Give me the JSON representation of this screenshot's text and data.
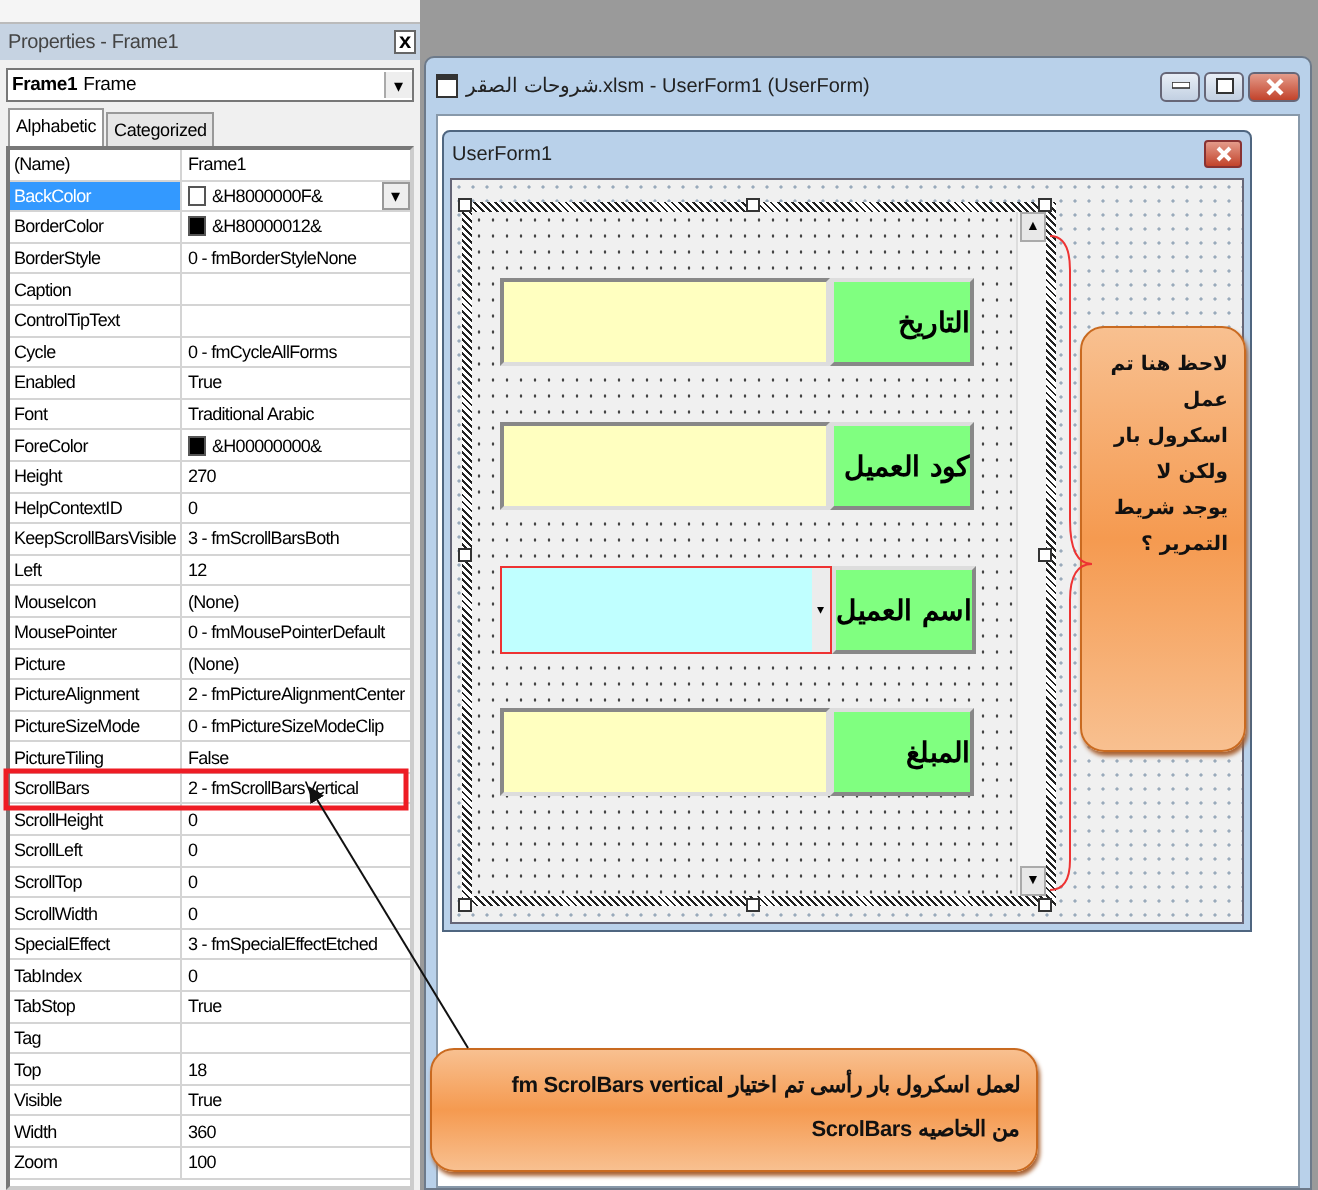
{
  "properties_window": {
    "title": "Properties - Frame1",
    "close_button": "x",
    "object_combo": {
      "name": "Frame1",
      "type": "Frame",
      "arrow": "▾"
    },
    "tabs": [
      {
        "label": "Alphabetic",
        "selected": true
      },
      {
        "label": "Categorized",
        "selected": false
      }
    ],
    "rows": [
      {
        "name": "(Name)",
        "value": "Frame1",
        "selected": false
      },
      {
        "name": "BackColor",
        "value": "&H8000000F&",
        "color": "#ffffff",
        "selected": true,
        "dropdown": "▾"
      },
      {
        "name": "BorderColor",
        "value": "&H80000012&",
        "color": "#000000",
        "selected": false
      },
      {
        "name": "BorderStyle",
        "value": "0 - fmBorderStyleNone",
        "selected": false
      },
      {
        "name": "Caption",
        "selected": false
      },
      {
        "name": "ControlTipText",
        "selected": false
      },
      {
        "name": "Cycle",
        "value": "0 - fmCycleAllForms",
        "selected": false
      },
      {
        "name": "Enabled",
        "value": "True",
        "selected": false
      },
      {
        "name": "Font",
        "value": "Traditional Arabic",
        "selected": false
      },
      {
        "name": "ForeColor",
        "value": "&H00000000&",
        "color": "#000000",
        "selected": false
      },
      {
        "name": "Height",
        "value": "270",
        "selected": false
      },
      {
        "name": "HelpContextID",
        "value": "0",
        "selected": false
      },
      {
        "name": "KeepScrollBarsVisible",
        "value": "3 - fmScrollBarsBoth",
        "selected": false
      },
      {
        "name": "Left",
        "value": "12",
        "selected": false
      },
      {
        "name": "MouseIcon",
        "value": "(None)",
        "selected": false
      },
      {
        "name": "MousePointer",
        "value": "0 - fmMousePointerDefault",
        "selected": false
      },
      {
        "name": "Picture",
        "value": "(None)",
        "selected": false
      },
      {
        "name": "PictureAlignment",
        "value": "2 - fmPictureAlignmentCenter",
        "selected": false
      },
      {
        "name": "PictureSizeMode",
        "value": "0 - fmPictureSizeModeClip",
        "selected": false
      },
      {
        "name": "PictureTiling",
        "value": "False",
        "selected": false
      },
      {
        "name": "ScrollBars",
        "value": "2 - fmScrollBarsVertical",
        "selected": false,
        "highlighted": true
      },
      {
        "name": "ScrollHeight",
        "value": "0",
        "selected": false
      },
      {
        "name": "ScrollLeft",
        "value": "0",
        "selected": false
      },
      {
        "name": "ScrollTop",
        "value": "0",
        "selected": false
      },
      {
        "name": "ScrollWidth",
        "value": "0",
        "selected": false
      },
      {
        "name": "SpecialEffect",
        "value": "3 - fmSpecialEffectEtched",
        "selected": false
      },
      {
        "name": "TabIndex",
        "value": "0",
        "selected": false
      },
      {
        "name": "TabStop",
        "value": "True",
        "selected": false
      },
      {
        "name": "Tag",
        "selected": false
      },
      {
        "name": "Top",
        "value": "18",
        "selected": false
      },
      {
        "name": "Visible",
        "value": "True",
        "selected": false
      },
      {
        "name": "Width",
        "value": "360",
        "selected": false
      },
      {
        "name": "Zoom",
        "value": "100",
        "selected": false
      }
    ]
  },
  "designer_window": {
    "title": "شروحات الصقر.xlsm - UserForm1 (UserForm)",
    "userform": {
      "title": "UserForm1",
      "fields": [
        {
          "label": "التاريخ",
          "kind": "textbox"
        },
        {
          "label": "كود العميل",
          "kind": "textbox"
        },
        {
          "label": "اسم العميل",
          "kind": "combobox",
          "arrow": "▾"
        },
        {
          "label": "المبلغ",
          "kind": "textbox"
        }
      ],
      "frame_scrollbar": {
        "up": "▲",
        "down": "▼"
      }
    },
    "side_note": "لاحظ هنا تم\nعمل\nاسكرول بار\nولكن لا\nيوجد شريط\nالتمرير ؟"
  },
  "bottom_note": "لعمل اسكرول بار رأسى تم اختيار  fm ScrolBars vertical\nمن الخاصيه  ScrolBars"
}
